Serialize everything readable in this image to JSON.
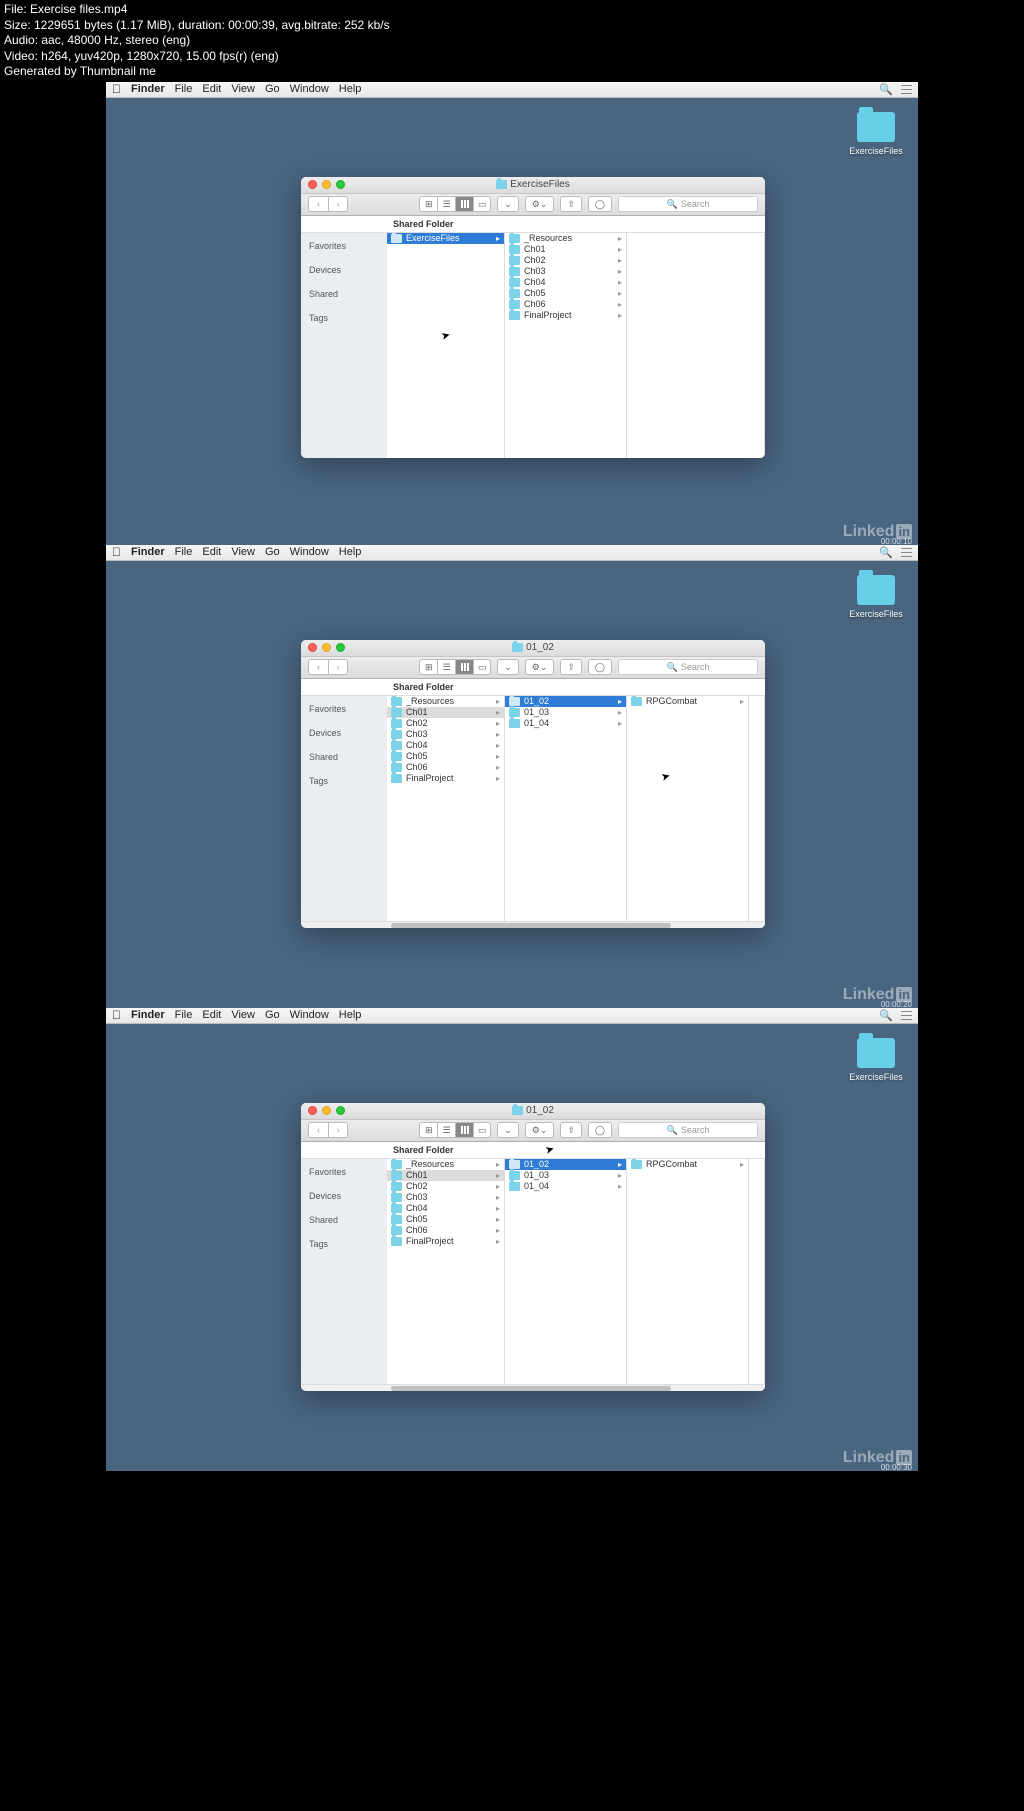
{
  "header": {
    "file": "File: Exercise files.mp4",
    "size": "Size: 1229651 bytes (1.17 MiB), duration: 00:00:39, avg.bitrate: 252 kb/s",
    "audio": "Audio: aac, 48000 Hz, stereo (eng)",
    "video": "Video: h264, yuv420p, 1280x720, 15.00 fps(r) (eng)",
    "gen": "Generated by Thumbnail me"
  },
  "menubar": {
    "finder": "Finder",
    "file": "File",
    "edit": "Edit",
    "view": "View",
    "go": "Go",
    "window": "Window",
    "help": "Help"
  },
  "desktopIcon": "ExerciseFiles",
  "watermark": {
    "linked": "Linked",
    "in": "in"
  },
  "search": {
    "placeholder": "Search"
  },
  "sidebar": {
    "favorites": "Favorites",
    "devices": "Devices",
    "shared": "Shared",
    "tags": "Tags"
  },
  "sharedFolder": "Shared Folder",
  "shot1": {
    "title": "ExerciseFiles",
    "timestamp": "00:00:10",
    "col1": [
      "ExerciseFiles"
    ],
    "col1Selected": 0,
    "col2": [
      "_Resources",
      "Ch01",
      "Ch02",
      "Ch03",
      "Ch04",
      "Ch05",
      "Ch06",
      "FinalProject"
    ]
  },
  "shot2": {
    "title": "01_02",
    "timestamp": "00:00:20",
    "col1": [
      "_Resources",
      "Ch01",
      "Ch02",
      "Ch03",
      "Ch04",
      "Ch05",
      "Ch06",
      "FinalProject"
    ],
    "col1Dim": 1,
    "col2": [
      "01_02",
      "01_03",
      "01_04"
    ],
    "col2Selected": 0,
    "col3": [
      "RPGCombat"
    ]
  },
  "shot3": {
    "title": "01_02",
    "timestamp": "00:00:30",
    "col1": [
      "_Resources",
      "Ch01",
      "Ch02",
      "Ch03",
      "Ch04",
      "Ch05",
      "Ch06",
      "FinalProject"
    ],
    "col1Dim": 1,
    "col2": [
      "01_02",
      "01_03",
      "01_04"
    ],
    "col2Selected": 0,
    "col3": [
      "RPGCombat"
    ]
  }
}
